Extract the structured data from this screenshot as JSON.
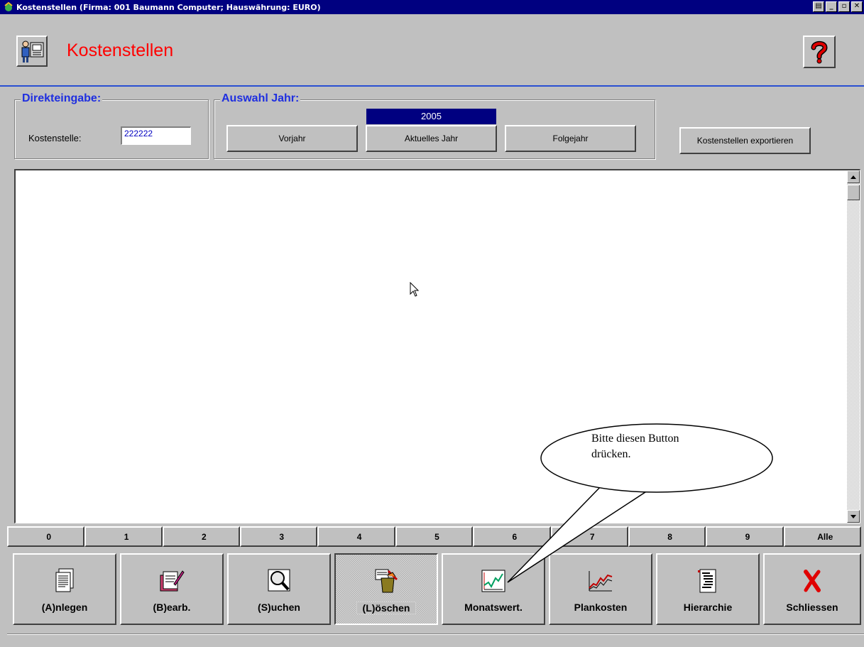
{
  "window": {
    "title": "Kostenstellen  (Firma: 001 Baumann Computer;  Hauswährung: EURO)",
    "controls": [
      "print",
      "minimize",
      "maximize",
      "close"
    ]
  },
  "header": {
    "title": "Kostenstellen",
    "icon": "user-at-desk-icon",
    "help_icon": "question-mark-icon"
  },
  "direkteingabe": {
    "legend": "Direkteingabe:",
    "label": "Kostenstelle:",
    "value": "222222"
  },
  "auswahl_jahr": {
    "legend": "Auswahl Jahr:",
    "year": "2005",
    "buttons": [
      "Vorjahr",
      "Aktuelles Jahr",
      "Folgejahr"
    ]
  },
  "export_button": "Kostenstellen exportieren",
  "number_bar": [
    "0",
    "1",
    "2",
    "3",
    "4",
    "5",
    "6",
    "7",
    "8",
    "9",
    "Alle"
  ],
  "toolbar": [
    {
      "label": "(A)nlegen",
      "icon": "new-document-icon"
    },
    {
      "label": "(B)earb.",
      "icon": "edit-document-icon"
    },
    {
      "label": "(S)uchen",
      "icon": "magnifier-icon"
    },
    {
      "label": "(L)öschen",
      "icon": "trash-icon",
      "pressed": true
    },
    {
      "label": "Monatswert.",
      "icon": "monthly-chart-icon"
    },
    {
      "label": "Plankosten",
      "icon": "planned-costs-chart-icon"
    },
    {
      "label": "Hierarchie",
      "icon": "hierarchy-document-icon"
    },
    {
      "label": "Schliessen",
      "icon": "red-x-icon"
    }
  ],
  "callout": {
    "line1": "Bitte diesen Button",
    "line2": "drücken."
  }
}
